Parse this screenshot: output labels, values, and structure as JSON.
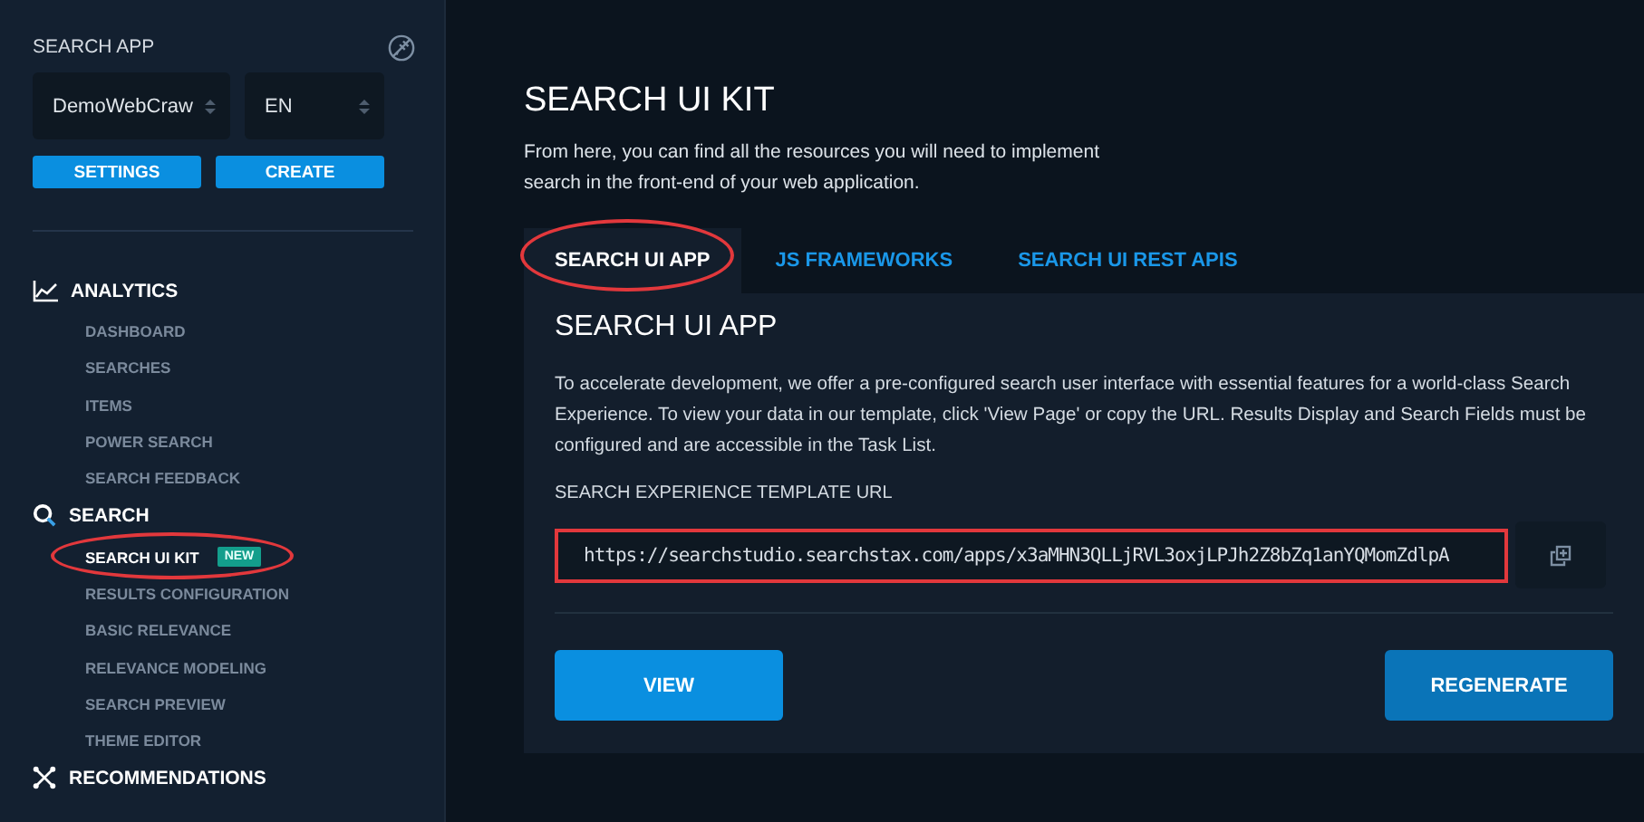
{
  "sidebar": {
    "app_label": "SEARCH APP",
    "app_select": {
      "value": "DemoWebCraw"
    },
    "language_select": {
      "value": "EN"
    },
    "buttons": [
      "SETTINGS",
      "CREATE"
    ],
    "sections": [
      {
        "title": "ANALYTICS",
        "kind": "analytics",
        "items": [
          {
            "label": "DASHBOARD",
            "selected": false,
            "highlighted": false
          },
          {
            "label": "SEARCHES",
            "selected": false,
            "highlighted": false
          },
          {
            "label": "ITEMS",
            "selected": false,
            "highlighted": false
          },
          {
            "label": "POWER SEARCH",
            "selected": false,
            "highlighted": false
          },
          {
            "label": "SEARCH FEEDBACK",
            "selected": false,
            "highlighted": false
          }
        ]
      },
      {
        "title": "SEARCH",
        "kind": "search",
        "items": [
          {
            "label": "SEARCH UI KIT",
            "selected": true,
            "highlighted": true,
            "badge": "NEW"
          },
          {
            "label": "RESULTS CONFIGURATION",
            "selected": false,
            "highlighted": false
          },
          {
            "label": "BASIC RELEVANCE",
            "selected": false,
            "highlighted": false
          },
          {
            "label": "RELEVANCE MODELING",
            "selected": false,
            "highlighted": false
          },
          {
            "label": "SEARCH PREVIEW",
            "selected": false,
            "highlighted": false
          },
          {
            "label": "THEME EDITOR",
            "selected": false,
            "highlighted": false
          }
        ]
      },
      {
        "title": "RECOMMENDATIONS",
        "kind": "recommendations"
      }
    ]
  },
  "page": {
    "title": "SEARCH UI KIT",
    "intro": "From here, you can find all the resources you will need to implement search in the front-end of your web application.",
    "tabs": [
      {
        "label": "SEARCH UI APP",
        "selected": true,
        "highlighted": true
      },
      {
        "label": "JS FRAMEWORKS",
        "selected": false,
        "highlighted": false
      },
      {
        "label": "SEARCH UI REST APIS",
        "selected": false,
        "highlighted": false
      }
    ],
    "panel": {
      "title": "SEARCH UI APP",
      "description": "To accelerate development, we offer a pre-configured search user interface with essential features for a world-class Search Experience. To view your data in our template, click 'View Page' or copy the URL. Results Display and Search Fields must be configured and are accessible in the Task List.",
      "url_label": "SEARCH EXPERIENCE TEMPLATE URL",
      "url": {
        "value": "https://searchstudio.searchstax.com/apps/x3aMHN3QLLjRVL3oxjLPJh2Z8bZq1anYQMomZdlpA",
        "highlighted": true
      },
      "buttons": [
        "VIEW",
        "REGENERATE"
      ]
    }
  }
}
